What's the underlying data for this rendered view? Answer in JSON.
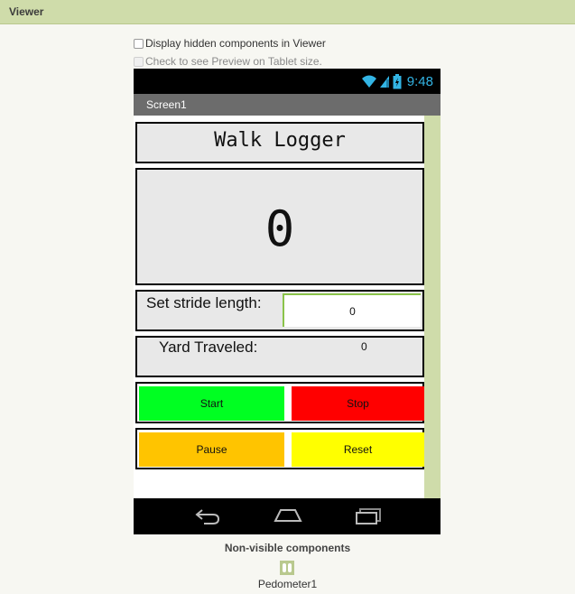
{
  "viewer": {
    "title": "Viewer"
  },
  "options": {
    "display_hidden": "Display hidden components in Viewer",
    "tablet_preview": "Check to see Preview on Tablet size."
  },
  "status_bar": {
    "time": "9:48",
    "icons": [
      "wifi-icon",
      "signal-icon",
      "battery-icon"
    ]
  },
  "screen": {
    "title": "Screen1"
  },
  "app": {
    "title": "Walk Logger",
    "counter": "0",
    "stride_label": "Set stride length:",
    "stride_value": "0",
    "yard_label": "Yard Traveled:",
    "yard_value": "0",
    "buttons": {
      "start": "Start",
      "stop": "Stop",
      "pause": "Pause",
      "reset": "Reset"
    }
  },
  "colors": {
    "start": "#00ff22",
    "stop": "#ff0000",
    "pause": "#ffc400",
    "reset": "#ffff00",
    "header": "#cfdcaa",
    "status_time": "#33b5e5"
  },
  "nav_bar": {
    "icons": [
      "back-icon",
      "home-icon",
      "recents-icon"
    ]
  },
  "non_visible": {
    "title": "Non-visible components",
    "items": [
      {
        "label": "Pedometer1",
        "icon": "pedometer-icon"
      }
    ]
  }
}
